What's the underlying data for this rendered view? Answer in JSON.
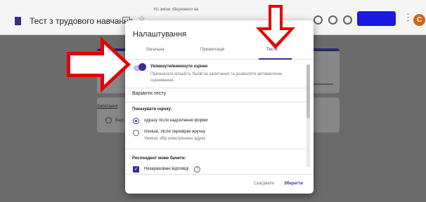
{
  "app": {
    "form_title": "Тест з трудового навчання",
    "save_status": "Усі зміни збережено на",
    "avatar_letter": "C"
  },
  "background": {
    "question_title": "Запитання",
    "option_text": "Варі"
  },
  "dialog": {
    "title": "Налаштування",
    "tabs": [
      {
        "label": "Загальна",
        "active": false
      },
      {
        "label": "Презентація",
        "active": false
      },
      {
        "label": "Тести",
        "active": true
      }
    ],
    "quiz_toggle": {
      "on": true,
      "label": "Увімкнути/вимкнути оцінки",
      "description": "Призначати кількість балів за запитання та дозволяти автоматичне оцінювання."
    },
    "quiz_options_title": "Варіанти тесту",
    "release_grade": {
      "title": "Показувати оцінку:",
      "options": [
        {
          "label": "одразу після надсилання форми",
          "description": "",
          "selected": true
        },
        {
          "label": "пізніше, після перевірки вручну",
          "description": "Умикає збір електронних адрес",
          "selected": false
        }
      ]
    },
    "respondent_can_see": {
      "title": "Респондент може бачити:",
      "items": [
        {
          "label": "Незараховані відповіді",
          "checked": true
        }
      ]
    },
    "buttons": {
      "cancel": "Скасувати",
      "save": "Зберегти"
    }
  },
  "colors": {
    "accent": "#3c2b99",
    "annotation_arrow": "#e40000",
    "overlay": "#6b6b6b",
    "send_button": "#1a1ae0"
  }
}
